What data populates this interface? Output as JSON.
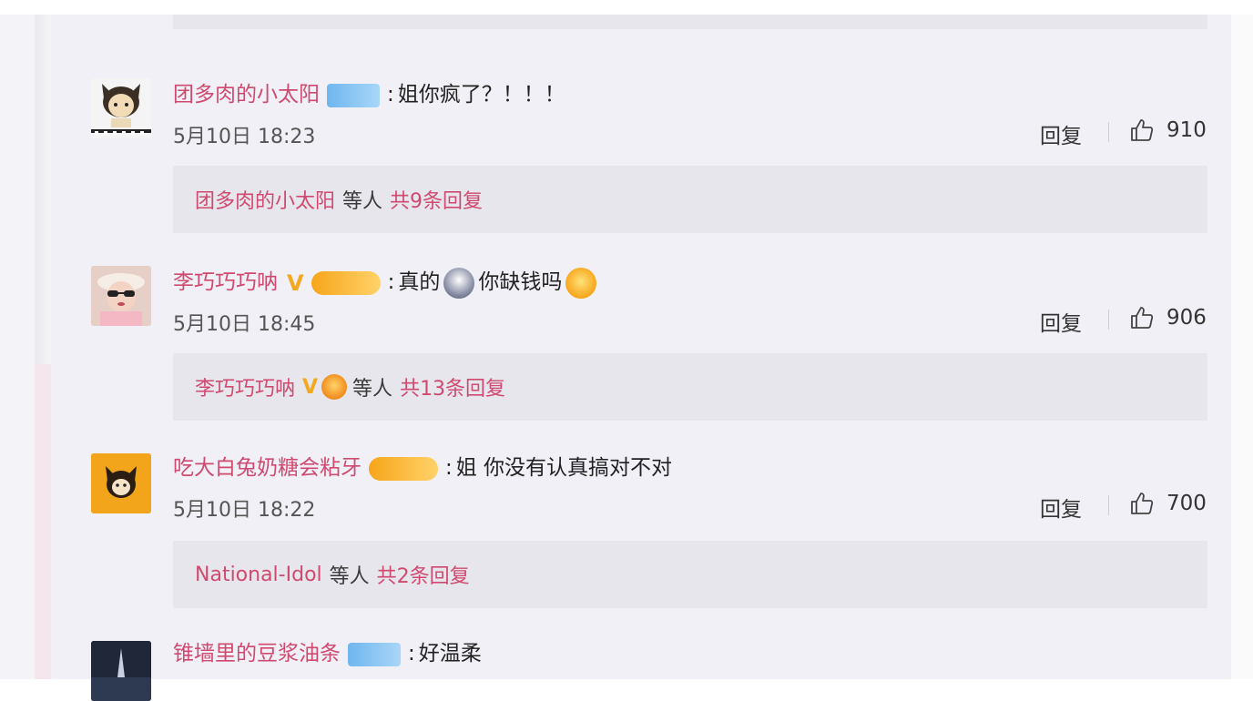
{
  "comments": [
    {
      "username": "团多肉的小太阳",
      "badge": "blue",
      "text": "姐你疯了？！！！",
      "date": "5月10日",
      "time": "18:23",
      "reply_label": "回复",
      "likes": "910",
      "thread": {
        "name": "团多肉的小太阳",
        "mid": "等人",
        "count": "共9条回复"
      }
    },
    {
      "username": "李巧巧巧呐",
      "badge": "gold",
      "verified": "V",
      "text_a": "真的",
      "text_b": "你缺钱吗",
      "date": "5月10日",
      "time": "18:45",
      "reply_label": "回复",
      "likes": "906",
      "thread": {
        "name": "李巧巧巧呐",
        "verified": "V",
        "mid": "等人",
        "count": "共13条回复"
      }
    },
    {
      "username": "吃大白兔奶糖会粘牙",
      "badge": "gold",
      "text": "姐 你没有认真搞对不对",
      "date": "5月10日",
      "time": "18:22",
      "reply_label": "回复",
      "likes": "700",
      "thread": {
        "name": "National-Idol",
        "mid": "等人",
        "count": "共2条回复"
      }
    },
    {
      "username": "锥墙里的豆浆油条",
      "badge": "blue",
      "text": "好温柔"
    }
  ],
  "colors": {
    "username": "#d04a70",
    "text": "#222222",
    "meta": "#555555",
    "reply_box_bg": "#e6e6ec"
  }
}
